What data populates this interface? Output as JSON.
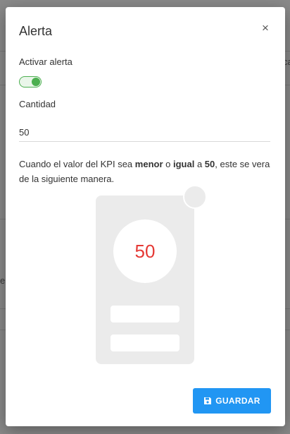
{
  "background": {
    "edge_text_right": "ca",
    "edge_text_left": "e"
  },
  "modal": {
    "title": "Alerta",
    "close_symbol": "×",
    "activate_label": "Activar alerta",
    "toggle_on": true,
    "quantity_label": "Cantidad",
    "quantity_value": "50",
    "description": {
      "part1": "Cuando el valor del KPI sea ",
      "bold1": "menor",
      "part2": " o ",
      "bold2": "igual",
      "part3": " a ",
      "bold3": "50",
      "part4": ", este se vera de la siguiente manera."
    },
    "preview": {
      "value": "50",
      "value_color": "#e53935"
    },
    "save_label": "GUARDAR",
    "save_icon": "floppy-disk-icon",
    "accent_color": "#2196f3",
    "toggle_color": "#4caf50"
  }
}
